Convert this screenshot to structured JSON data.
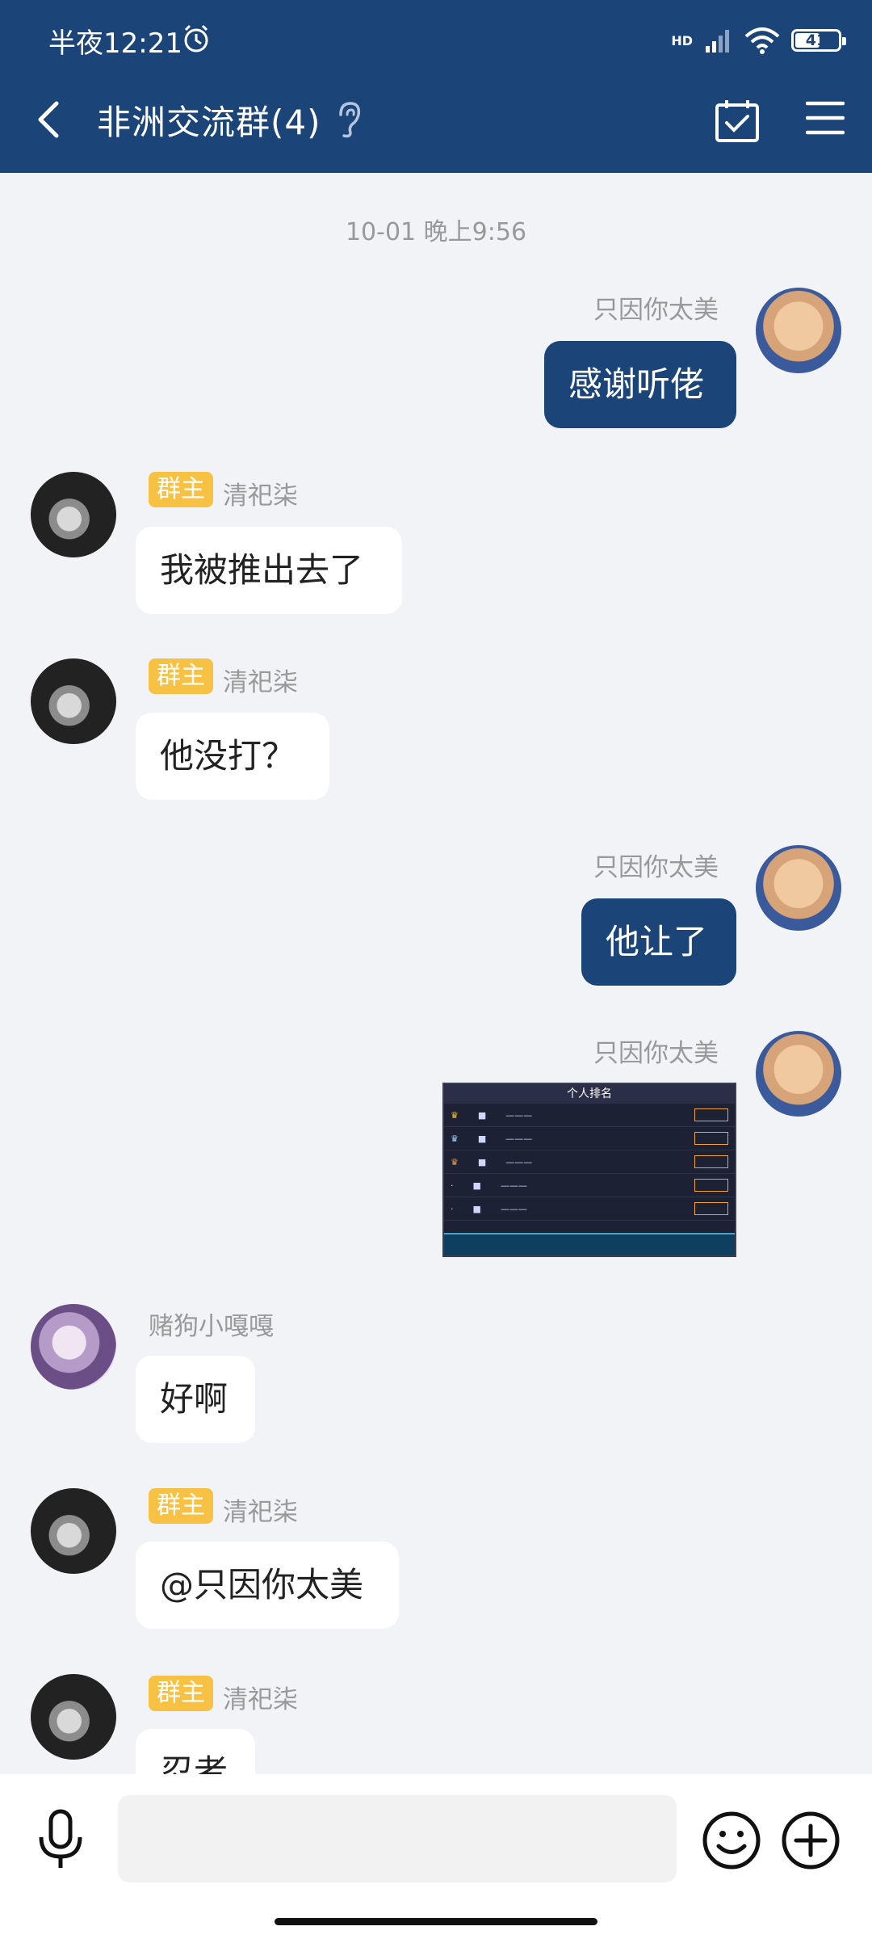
{
  "status_bar": {
    "time": "半夜12:21",
    "battery": "41",
    "network": "HD"
  },
  "header": {
    "title": "非洲交流群(4)"
  },
  "chat": {
    "timestamp": "10-01 晚上9:56",
    "messages": [
      {
        "side": "out",
        "sender": "只因你太美",
        "text": "感谢听佬"
      },
      {
        "side": "in",
        "badge": "群主",
        "sender": "清祀柒",
        "text": "我被推出去了"
      },
      {
        "side": "in",
        "badge": "群主",
        "sender": "清祀柒",
        "text": "他没打？"
      },
      {
        "side": "out",
        "sender": "只因你太美",
        "text": "他让了"
      },
      {
        "side": "out",
        "sender": "只因你太美",
        "image": {
          "title": "个人排名"
        }
      },
      {
        "side": "in",
        "sender": "赌狗小嘎嘎",
        "text": "好啊"
      },
      {
        "side": "in",
        "badge": "群主",
        "sender": "清祀柒",
        "text": "@只因你太美"
      },
      {
        "side": "in",
        "badge": "群主",
        "sender": "清祀柒",
        "text": "忍者"
      }
    ]
  },
  "footer": {
    "input_placeholder": ""
  }
}
